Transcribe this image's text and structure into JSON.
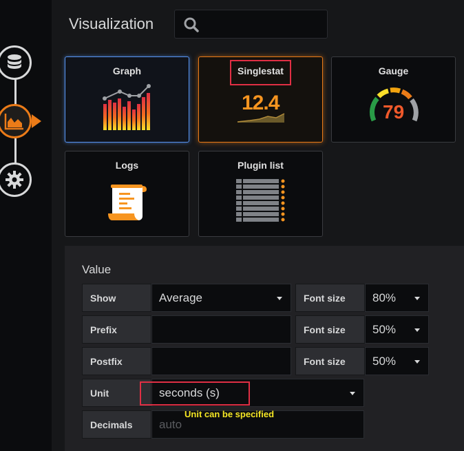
{
  "sidebar": {
    "items": [
      {
        "icon": "database-icon",
        "active": false
      },
      {
        "icon": "chart-area-icon",
        "active": true
      },
      {
        "icon": "gear-icon",
        "active": false
      }
    ]
  },
  "header": {
    "title": "Visualization",
    "search_placeholder": ""
  },
  "visualizations": [
    {
      "name": "Graph",
      "icon": "graph-icon",
      "state": "selected"
    },
    {
      "name": "Singlestat",
      "icon": "singlestat-icon",
      "state": "hovered",
      "preview_value": "12.4"
    },
    {
      "name": "Gauge",
      "icon": "gauge-icon",
      "state": "normal",
      "preview_value": "79"
    },
    {
      "name": "Logs",
      "icon": "logs-icon",
      "state": "normal"
    },
    {
      "name": "Plugin list",
      "icon": "plugin-list-icon",
      "state": "normal"
    }
  ],
  "value_section": {
    "title": "Value",
    "show_label": "Show",
    "show_value": "Average",
    "prefix_label": "Prefix",
    "prefix_value": "",
    "postfix_label": "Postfix",
    "postfix_value": "",
    "unit_label": "Unit",
    "unit_value": "seconds (s)",
    "decimals_label": "Decimals",
    "decimals_placeholder": "auto",
    "font_size_label": "Font size",
    "font_sizes": [
      "80%",
      "50%",
      "50%"
    ]
  },
  "annotation": {
    "text": "Unit can be specified",
    "color": "#f5e624",
    "highlight_color": "#e02f44"
  },
  "colors": {
    "accent": "#eb7b18",
    "selected": "#5794f2"
  }
}
